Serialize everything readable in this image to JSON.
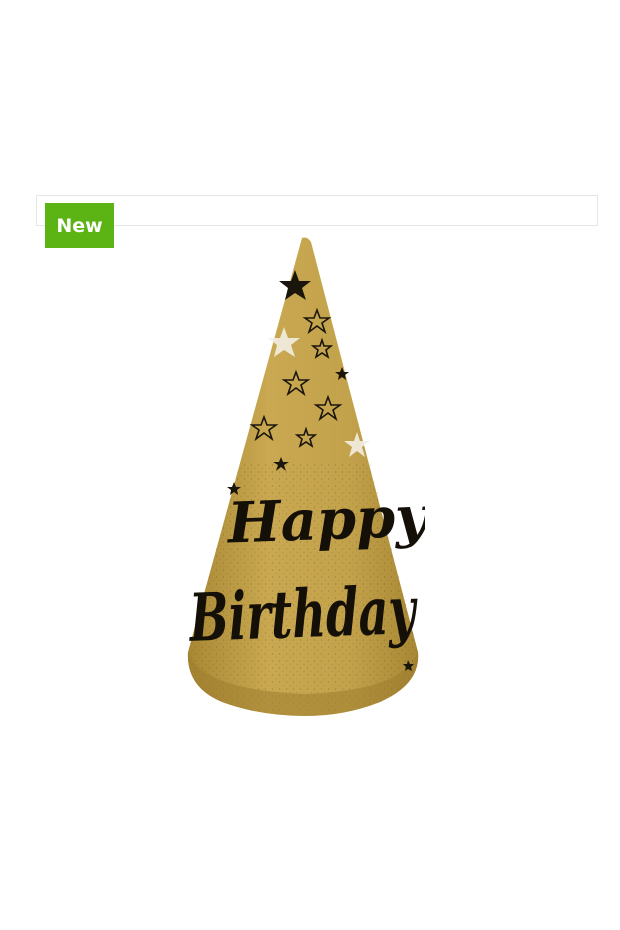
{
  "badge": {
    "label": "New"
  },
  "hat": {
    "line1": "Happy",
    "line2": "Birthday",
    "colors": {
      "gold": "#c3a24c",
      "gold_dark": "#a98834",
      "ink": "#141008",
      "badge_green": "#5cb414"
    },
    "icon": "party-hat"
  }
}
